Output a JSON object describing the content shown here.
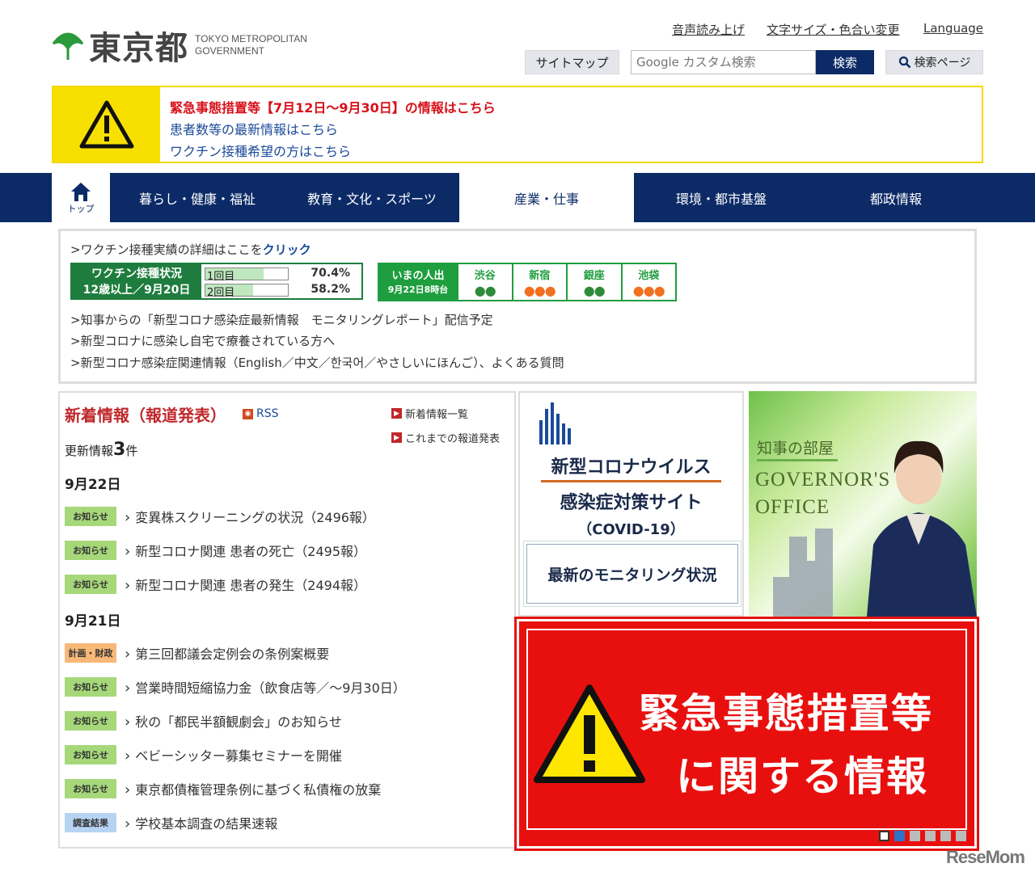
{
  "header": {
    "logo_ja": "東京都",
    "logo_en1": "TOKYO METROPOLITAN",
    "logo_en2": "GOVERNMENT",
    "utility": [
      "音声読み上げ",
      "文字サイズ・色合い変更",
      "Language"
    ],
    "sitemap": "サイトマップ",
    "search_placeholder": "Google カスタム検索",
    "search_button": "検索",
    "search_page": "検索ページ"
  },
  "alert": {
    "line1": "緊急事態措置等【7月12日～9月30日】の情報はこちら",
    "line2": "患者数等の最新情報はこちら",
    "line3": "ワクチン接種希望の方はこちら"
  },
  "nav": {
    "home": "トップ",
    "items": [
      "暮らし・健康・福祉",
      "教育・文化・スポーツ",
      "産業・仕事",
      "環境・都市基盤",
      "都政情報"
    ]
  },
  "covid_box": {
    "link1_prefix": ">ワクチン接種実績の詳細はここを",
    "link1_bold": "クリック",
    "vaccine": {
      "label1": "ワクチン接種状況",
      "label2": "12歳以上／9月20日",
      "dose1": "1回目",
      "dose1_pct": "70.4%",
      "dose1_value": 70.4,
      "dose2": "2回目",
      "dose2_pct": "58.2%",
      "dose2_value": 58.2
    },
    "crowd": {
      "label1": "いまの人出",
      "label2": "9月22日8時台",
      "areas": [
        {
          "name": "渋谷",
          "level": 2
        },
        {
          "name": "新宿",
          "level": 3
        },
        {
          "name": "銀座",
          "level": 2
        },
        {
          "name": "池袋",
          "level": 3
        }
      ]
    },
    "link2": ">知事からの「新型コロナ感染症最新情報　モニタリングレポート」配信予定",
    "link3": ">新型コロナに感染し自宅で療養されている方へ",
    "link4": ">新型コロナ感染症関連情報（English／中文／한국어／やさしいにほんご）、よくある質問"
  },
  "news": {
    "title": "新着情報（報道発表）",
    "rss": "RSS",
    "list_link": "新着情報一覧",
    "archive_link": "これまでの報道発表",
    "update_prefix": "更新情報",
    "update_count": "3",
    "update_suffix": "件",
    "date1": "9月22日",
    "date2": "9月21日",
    "items1": [
      {
        "cat": "お知らせ",
        "text": "変異株スクリーニングの状況（2496報）"
      },
      {
        "cat": "お知らせ",
        "text": "新型コロナ関連 患者の死亡（2495報）"
      },
      {
        "cat": "お知らせ",
        "text": "新型コロナ関連 患者の発生（2494報）"
      }
    ],
    "items2": [
      {
        "cat": "計画・財政",
        "text": "第三回都議会定例会の条例案概要"
      },
      {
        "cat": "お知らせ",
        "text": "営業時間短縮協力金（飲食店等／～9月30日）"
      },
      {
        "cat": "お知らせ",
        "text": "秋の「都民半額観劇会」のお知らせ"
      },
      {
        "cat": "お知らせ",
        "text": "ベビーシッター募集セミナーを開催"
      },
      {
        "cat": "お知らせ",
        "text": "東京都債権管理条例に基づく私債権の放棄"
      },
      {
        "cat": "調査結果",
        "text": "学校基本調査の結果速報"
      }
    ]
  },
  "covid_site": {
    "line1": "新型コロナウイルス",
    "line2": "感染症対策サイト",
    "line3": "（COVID-19）",
    "button": "最新のモニタリング状況"
  },
  "governor": {
    "ja": "知事の部屋",
    "en1": "GOVERNOR'S",
    "en2": "OFFICE"
  },
  "emergency": {
    "line1": "緊急事態措置等",
    "line2": "に関する情報"
  },
  "watermark": "ReseMom",
  "colors": {
    "navy": "#0b2a66",
    "red": "#c0282b",
    "banner_red": "#e8100e",
    "alert_yellow": "#f7e000",
    "vaccine_green": "#1e7d3e"
  }
}
